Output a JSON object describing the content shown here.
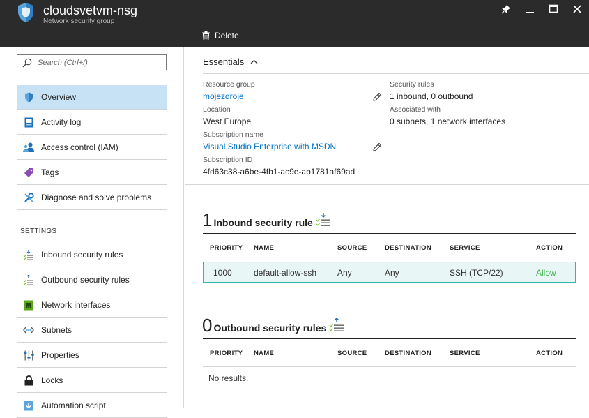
{
  "header": {
    "title": "cloudsvetvm-nsg",
    "subtitle": "Network security group",
    "delete_label": "Delete"
  },
  "search": {
    "placeholder": "Search (Ctrl+/)"
  },
  "nav": {
    "items": [
      {
        "label": "Overview",
        "icon": "shield-icon"
      },
      {
        "label": "Activity log",
        "icon": "activity-log-icon"
      },
      {
        "label": "Access control (IAM)",
        "icon": "users-icon"
      },
      {
        "label": "Tags",
        "icon": "tag-icon"
      },
      {
        "label": "Diagnose and solve problems",
        "icon": "wrench-icon"
      }
    ],
    "settings_label": "SETTINGS",
    "settings_items": [
      {
        "label": "Inbound security rules",
        "icon": "inbound-rules-icon"
      },
      {
        "label": "Outbound security rules",
        "icon": "outbound-rules-icon"
      },
      {
        "label": "Network interfaces",
        "icon": "network-interface-icon"
      },
      {
        "label": "Subnets",
        "icon": "subnet-icon"
      },
      {
        "label": "Properties",
        "icon": "properties-icon"
      },
      {
        "label": "Locks",
        "icon": "lock-icon"
      },
      {
        "label": "Automation script",
        "icon": "automation-icon"
      }
    ]
  },
  "essentials": {
    "title": "Essentials",
    "resource_group_label": "Resource group",
    "resource_group": "mojezdroje",
    "location_label": "Location",
    "location": "West Europe",
    "subscription_name_label": "Subscription name",
    "subscription_name": "Visual Studio Enterprise with MSDN",
    "subscription_id_label": "Subscription ID",
    "subscription_id": "4fd63c38-a6be-4fb1-ac9e-ab1781af69ad",
    "security_rules_label": "Security rules",
    "security_rules": "1 inbound, 0 outbound",
    "associated_label": "Associated with",
    "associated": "0 subnets, 1 network interfaces"
  },
  "inbound": {
    "count": "1",
    "title": "Inbound security rule",
    "columns": [
      "PRIORITY",
      "NAME",
      "SOURCE",
      "DESTINATION",
      "SERVICE",
      "ACTION"
    ],
    "rows": [
      {
        "priority": "1000",
        "name": "default-allow-ssh",
        "source": "Any",
        "destination": "Any",
        "service": "SSH (TCP/22)",
        "action": "Allow"
      }
    ]
  },
  "outbound": {
    "count": "0",
    "title": "Outbound security rules",
    "columns": [
      "PRIORITY",
      "NAME",
      "SOURCE",
      "DESTINATION",
      "SERVICE",
      "ACTION"
    ],
    "empty_text": "No results."
  },
  "colors": {
    "header_bg": "#2b2b2b",
    "link": "#0072c6",
    "selected_nav": "#c6e2f4",
    "allow": "#3cb44b",
    "row_border": "#34b5ac"
  }
}
